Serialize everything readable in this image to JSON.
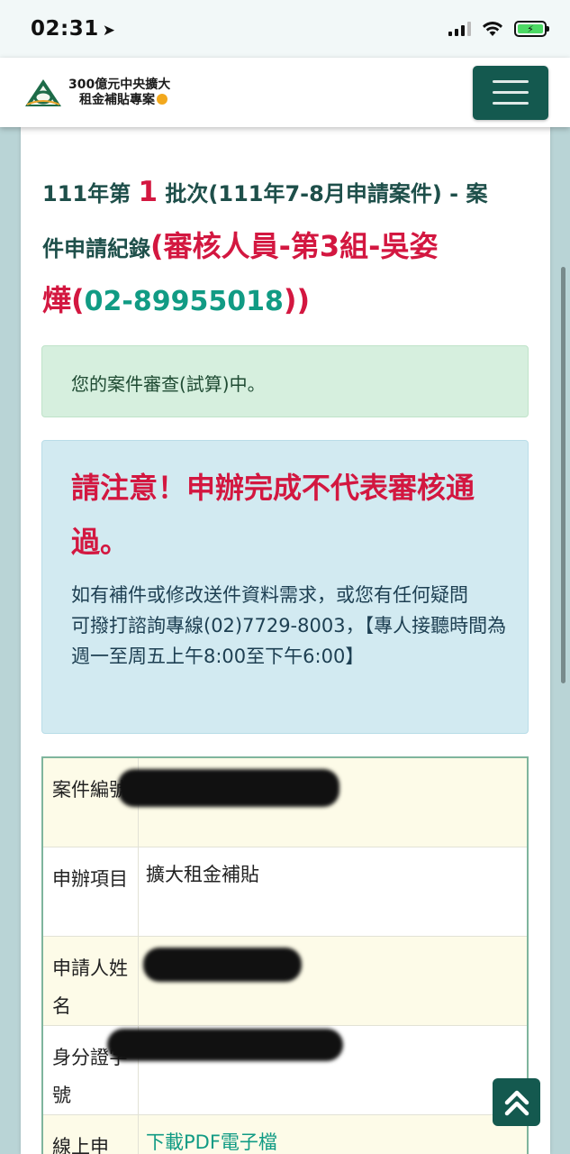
{
  "status_bar": {
    "time": "02:31",
    "location_glyph": "➤",
    "battery_glyph": "⚡"
  },
  "header": {
    "logo_line1": "300億元中央擴大",
    "logo_line2": "租金補貼專案",
    "brand_color": "#14594f"
  },
  "heading": {
    "part1": "111年第",
    "batch_no": "1",
    "part2": "批次(111年7-8月申請案件) - 案",
    "part3": "件申請紀錄",
    "reviewer_prefix": "(審核人員-第3組-吳姿",
    "reviewer_name_end": "燁(",
    "phone": "02-89955018",
    "suffix": "))"
  },
  "status_alert": {
    "text": "您的案件審查(試算)中。"
  },
  "notice": {
    "warning": "請注意！申辦完成不代表審核通過。",
    "line1": "如有補件或修改送件資料需求，或您有任何疑問",
    "line2": "可撥打諮詢專線(02)7729-8003，【專人接聽時間為週一至周五上午8:00至下午6:00】"
  },
  "table": {
    "rows": [
      {
        "label": "案件編號",
        "value": ""
      },
      {
        "label": "申辦項目",
        "value": "擴大租金補貼"
      },
      {
        "label": "申請人姓名",
        "value": ""
      },
      {
        "label": "身分證字號",
        "value": ""
      },
      {
        "label": "線上申",
        "value": "下載PDF電子檔"
      }
    ]
  },
  "colors": {
    "accent_red": "#d31740",
    "teal": "#119b84",
    "heading": "#1e4f4a"
  }
}
